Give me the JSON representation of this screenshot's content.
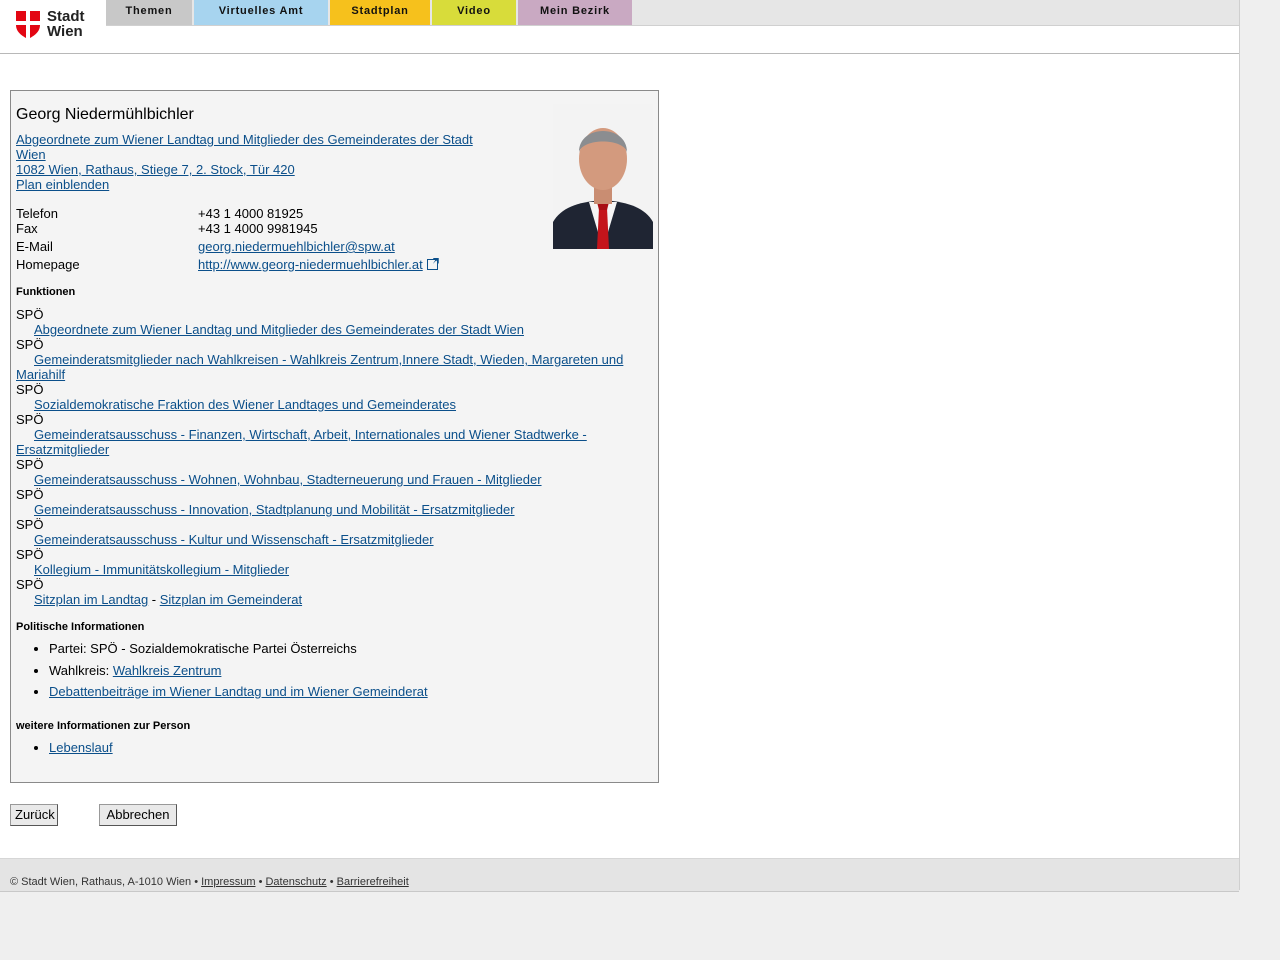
{
  "header": {
    "logo_text_1": "Stadt",
    "logo_text_2": "Wien",
    "logo_color": "#e30613",
    "tabs": [
      {
        "label": "Themen",
        "color": "#c8c8c8"
      },
      {
        "label": "Virtuelles Amt",
        "color": "#a7d4ef"
      },
      {
        "label": "Stadtplan",
        "color": "#f6c11c"
      },
      {
        "label": "Video",
        "color": "#d8dc3a"
      },
      {
        "label": "Mein Bezirk",
        "color": "#c9a9c2"
      }
    ]
  },
  "person": {
    "name": "Georg Niedermühlbichler",
    "role_link": "Abgeordnete zum Wiener Landtag und Mitglieder des Gemeinderates der Stadt Wien",
    "address": "1082 Wien, Rathaus, Stiege 7, 2. Stock, Tür 420",
    "plan_link": "Plan einblenden",
    "contact": {
      "telefon_label": "Telefon",
      "telefon": "+43 1 4000 81925",
      "fax_label": "Fax",
      "fax": "+43 1 4000 9981945",
      "email_label": "E-Mail",
      "email": "georg.niedermuehlbichler@spw.at",
      "homepage_label": "Homepage",
      "homepage": "http://www.georg-niedermuehlbichler.at"
    }
  },
  "funktionen": {
    "heading": "Funktionen",
    "items": [
      {
        "party": "SPÖ",
        "role": "Abgeordnete zum Wiener Landtag und Mitglieder des Gemeinderates der Stadt Wien"
      },
      {
        "party": "SPÖ",
        "role": "Gemeinderatsmitglieder nach Wahlkreisen - Wahlkreis Zentrum,Innere Stadt, Wieden, Margareten und Mariahilf"
      },
      {
        "party": "SPÖ",
        "role": "Sozialdemokratische Fraktion des Wiener Landtages und Gemeinderates"
      },
      {
        "party": "SPÖ",
        "role": "Gemeinderatsausschuss - Finanzen, Wirtschaft, Arbeit, Internationales und Wiener Stadtwerke - Ersatzmitglieder"
      },
      {
        "party": "SPÖ",
        "role": "Gemeinderatsausschuss - Wohnen, Wohnbau, Stadterneuerung und Frauen - Mitglieder"
      },
      {
        "party": "SPÖ",
        "role": "Gemeinderatsausschuss - Innovation, Stadtplanung und Mobilität - Ersatzmitglieder"
      },
      {
        "party": "SPÖ",
        "role": "Gemeinderatsausschuss - Kultur und Wissenschaft - Ersatzmitglieder"
      },
      {
        "party": "SPÖ",
        "role": "Kollegium - Immunitätskollegium - Mitglieder"
      }
    ],
    "last_party": "SPÖ",
    "sitzplan_landtag": "Sitzplan im Landtag",
    "separator": " - ",
    "sitzplan_gemeinderat": "Sitzplan im Gemeinderat"
  },
  "politisch": {
    "heading": "Politische Informationen",
    "partei": "Partei: SPÖ - Sozialdemokratische Partei Österreichs",
    "wahlkreis_label": "Wahlkreis: ",
    "wahlkreis_link": "Wahlkreis Zentrum",
    "debatten": "Debattenbeiträge im Wiener Landtag und im Wiener Gemeinderat"
  },
  "weitere": {
    "heading": "weitere Informationen zur Person",
    "lebenslauf": "Lebenslauf"
  },
  "buttons": {
    "back": "Zurück",
    "cancel": "Abbrechen"
  },
  "footer": {
    "copyright": "© Stadt Wien, Rathaus, A-1010 Wien • ",
    "impressum": "Impressum",
    "sep1": " • ",
    "datenschutz": "Datenschutz",
    "sep2": " • ",
    "barrierefreiheit": "Barrierefreiheit"
  }
}
